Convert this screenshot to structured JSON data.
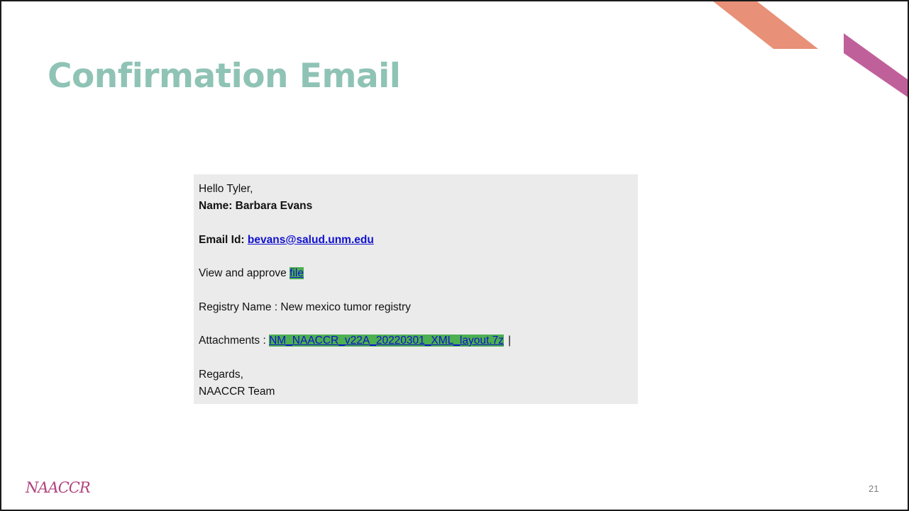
{
  "slide": {
    "title": "Confirmation Email",
    "page_number": "21",
    "logo_text": "NAACCR",
    "colors": {
      "title": "#8fc3b5",
      "accent_orange": "#e89078",
      "accent_pink": "#c0609a",
      "email_background": "#ebebeb",
      "highlight": "#4caf50",
      "link": "#1010d0"
    }
  },
  "email": {
    "greeting": "Hello Tyler,",
    "name_label": "Name: Barbara Evans",
    "email_label": "Email Id: ",
    "email_value": "bevans@salud.unm.edu",
    "approve_text": "View and approve ",
    "approve_link": "file",
    "registry": "Registry Name : New mexico tumor registry",
    "attachments_label": "Attachments : ",
    "attachment_file": "NM_NAACCR_v22A_20220301_XML_layout.7z",
    "text_cursor": "|",
    "regards": "Regards,",
    "team": "NAACCR Team"
  }
}
